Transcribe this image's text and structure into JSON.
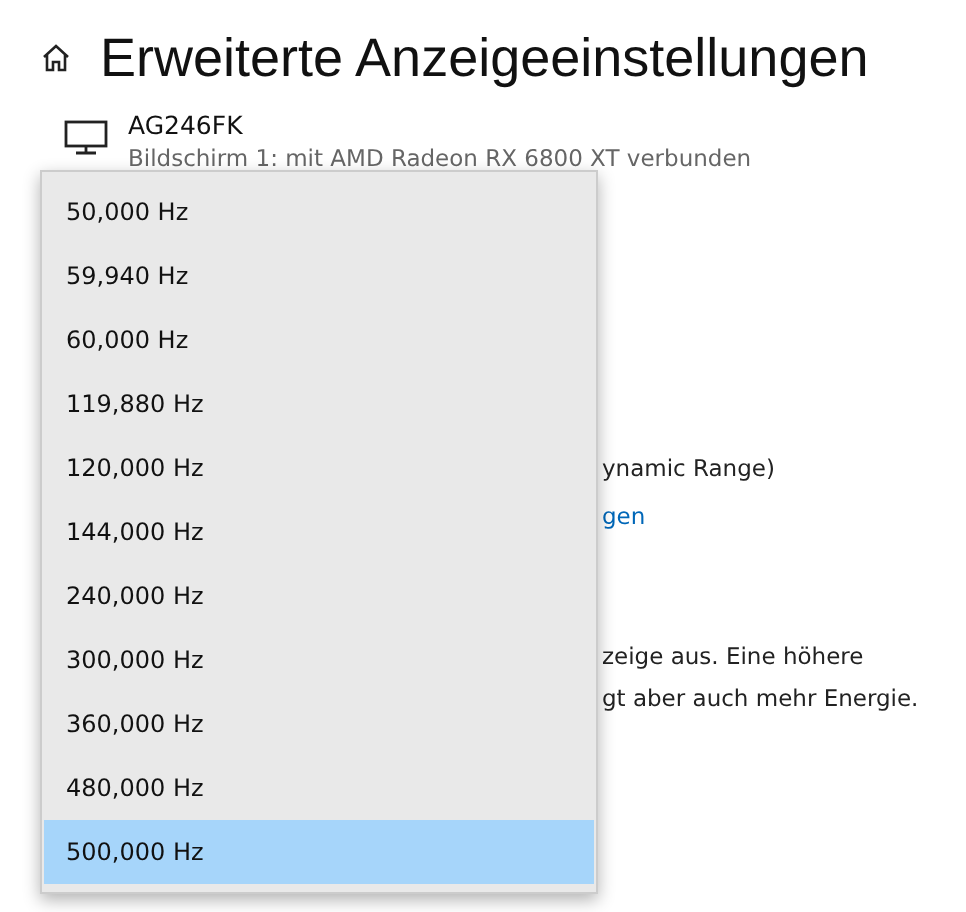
{
  "header": {
    "title": "Erweiterte Anzeigeeinstellungen"
  },
  "display": {
    "name": "AG246FK",
    "description": "Bildschirm 1: mit AMD Radeon RX 6800 XT verbunden"
  },
  "background_texts": [
    {
      "kind": "text",
      "text": "ynamic Range)"
    },
    {
      "kind": "link",
      "text": "gen"
    },
    {
      "kind": "text",
      "text": "zeige aus. Eine höhere"
    },
    {
      "kind": "text",
      "text": "gt aber auch mehr Energie."
    }
  ],
  "refresh_rate_dropdown": {
    "options": [
      {
        "label": "50,000 Hz",
        "selected": false
      },
      {
        "label": "59,940 Hz",
        "selected": false
      },
      {
        "label": "60,000 Hz",
        "selected": false
      },
      {
        "label": "119,880 Hz",
        "selected": false
      },
      {
        "label": "120,000 Hz",
        "selected": false
      },
      {
        "label": "144,000 Hz",
        "selected": false
      },
      {
        "label": "240,000 Hz",
        "selected": false
      },
      {
        "label": "300,000 Hz",
        "selected": false
      },
      {
        "label": "360,000 Hz",
        "selected": false
      },
      {
        "label": "480,000 Hz",
        "selected": false
      },
      {
        "label": "500,000 Hz",
        "selected": true
      }
    ]
  }
}
